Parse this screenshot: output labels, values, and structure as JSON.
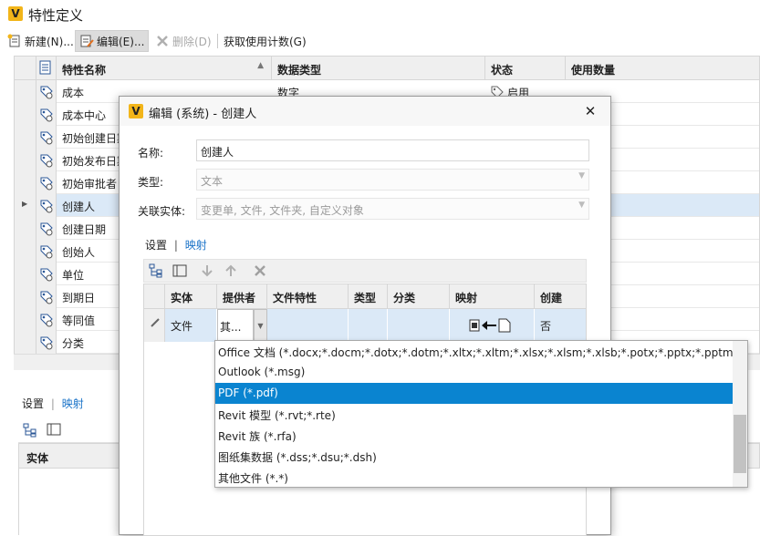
{
  "app": {
    "title": "特性定义"
  },
  "toolbar": {
    "new_label": "新建(N)...",
    "edit_label": "编辑(E)...",
    "delete_label": "删除(D)",
    "usage_label": "获取使用计数(G)"
  },
  "grid": {
    "columns": [
      "特性名称",
      "数据类型",
      "状态",
      "使用数量"
    ],
    "rows": [
      {
        "name": "成本",
        "type": "数字",
        "status": "启用"
      },
      {
        "name": "成本中心"
      },
      {
        "name": "初始创建日期"
      },
      {
        "name": "初始发布日期"
      },
      {
        "name": "初始审批者"
      },
      {
        "name": "创建人"
      },
      {
        "name": "创建日期"
      },
      {
        "name": "创始人"
      },
      {
        "name": "单位"
      },
      {
        "name": "到期日"
      },
      {
        "name": "等同值"
      },
      {
        "name": "分类"
      }
    ],
    "selected_row": 5
  },
  "bottom": {
    "tab_settings": "设置",
    "tab_mapping": "映射",
    "col_entity": "实体"
  },
  "dialog": {
    "title": "编辑 (系统) - 创建人",
    "name_label": "名称:",
    "name_value": "创建人",
    "type_label": "类型:",
    "type_value": "文本",
    "entity_label": "关联实体:",
    "entity_value": "变更单, 文件, 文件夹, 自定义对象",
    "tab_settings": "设置",
    "tab_mapping": "映射",
    "mapping_grid": {
      "columns": [
        "实体",
        "提供者",
        "文件特性",
        "类型",
        "分类",
        "映射",
        "创建"
      ],
      "row": {
        "entity": "文件",
        "provider": "其...",
        "create": "否"
      }
    }
  },
  "dropdown": {
    "options": [
      "Office 文档 (*.docx;*.docm;*.dotx;*.dotm;*.xltx;*.xltm;*.xlsx;*.xlsm;*.xlsb;*.potx;*.pptx;*.pptm;*.potm)",
      "Outlook (*.msg)",
      "PDF (*.pdf)",
      "Revit 模型 (*.rvt;*.rte)",
      "Revit 族 (*.rfa)",
      "图纸集数据 (*.dss;*.dsu;*.dsh)",
      "其他文件 (*.*)"
    ],
    "selected_index": 2
  },
  "colors": {
    "accent": "#0a84d0",
    "selection": "#dbe9f7",
    "logo": "#f2b51a"
  }
}
